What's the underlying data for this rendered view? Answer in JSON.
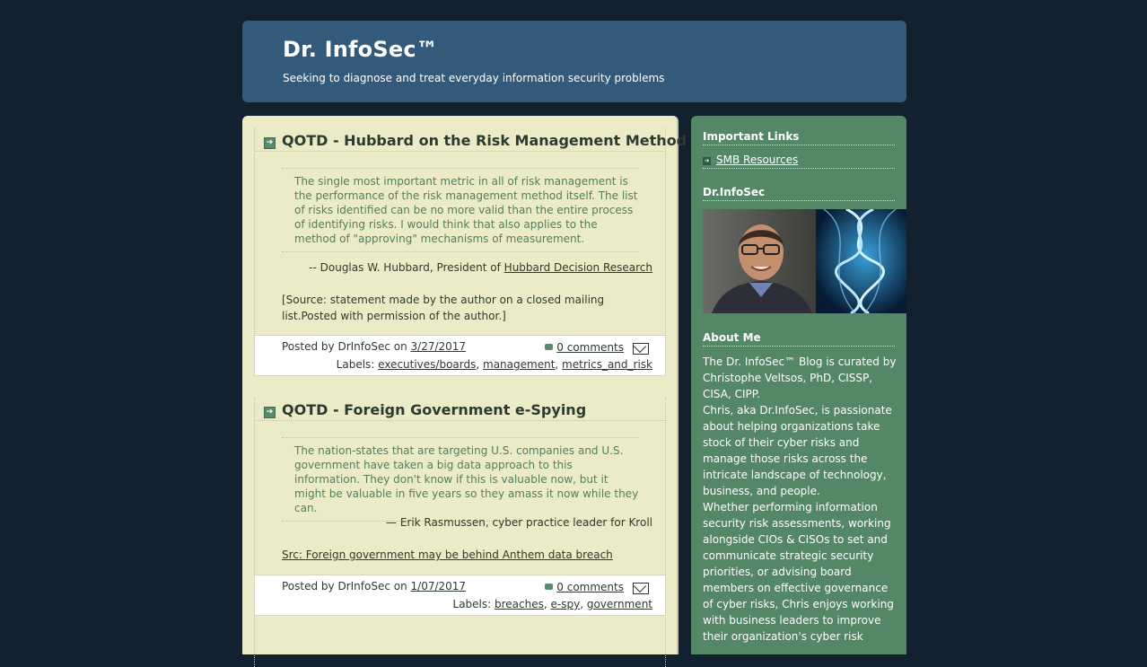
{
  "header": {
    "title": "Dr. InfoSec™",
    "description": "Seeking to diagnose and treat everyday information security problems"
  },
  "posts": [
    {
      "title": "QOTD - Hubbard on the Risk Management Method",
      "quote": "The single most important metric in all of risk management is the performance of the risk management method itself. The list of risks identified can be no more valid than the entire process of identifying risks. I would think that also applies to the method of \"approving\" mechanisms of measurement.",
      "attribution_prefix": "-- Douglas W. Hubbard, President of ",
      "attribution_link": "Hubbard Decision Research",
      "source": "[Source: statement made by the author on a closed mailing list.Posted with permission of the author.]",
      "posted_prefix": "Posted by DrInfoSec on ",
      "date": "3/27/2017",
      "comments": "0 comments",
      "labels_prefix": "Labels: ",
      "labels": [
        "executives/boards",
        "management",
        "metrics_and_risk"
      ]
    },
    {
      "title": "QOTD - Foreign Government e-Spying",
      "quote": "The nation-states that are targeting U.S. companies and U.S. government have taken a big data approach to this information. They don't know if this is valuable now, but it might be valuable in five years so they amass it now while they can.",
      "attribution": "— Erik Rasmussen, cyber practice leader for Kroll",
      "source_link": "Src: Foreign government may be behind Anthem data breach",
      "posted_prefix": "Posted by DrInfoSec on ",
      "date": "1/07/2017",
      "comments": "0 comments",
      "labels_prefix": "Labels: ",
      "labels": [
        "breaches",
        "e-spy",
        "government"
      ]
    }
  ],
  "sidebar": {
    "links_heading": "Important Links",
    "links": [
      "SMB Resources"
    ],
    "profile_heading": "Dr.InfoSec",
    "about_heading": "About Me",
    "about_paragraphs": [
      "The Dr. InfoSec™ Blog is curated by Christophe Veltsos, PhD, CISSP, CISA, CIPP.",
      "Chris, aka Dr.InfoSec, is passionate about helping organizations take stock of their cyber risks and manage those risks across the intricate landscape of technology, business, and people.",
      "Whether performing information security risk assessments, working alongside CIOs & CISOs to set and communicate strategic security priorities, or advising board members on effective governance of cyber risks, Chris enjoys working with business leaders to improve their organization's cyber risk"
    ]
  },
  "colors": {
    "page_bg": "#13202f",
    "header_bg": "#335a7a",
    "main_bg": "#ecebc7",
    "sidebar_bg": "#548766",
    "quote_text": "#4f7f60"
  }
}
